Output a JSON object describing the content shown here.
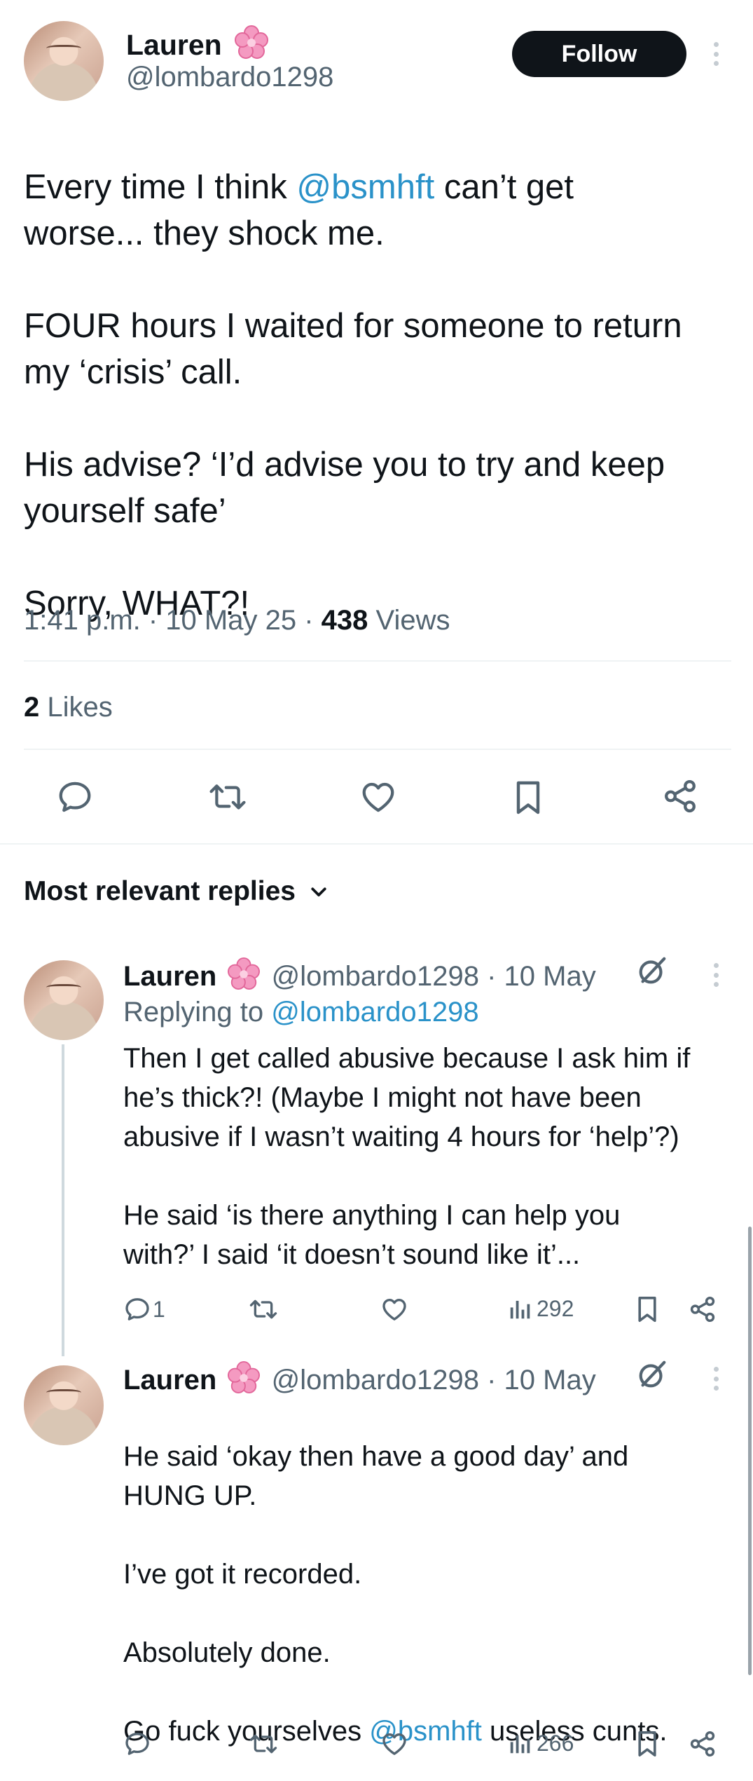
{
  "tweet": {
    "author_name": "Lauren",
    "author_handle": "@lombardo1298",
    "follow_label": "Follow",
    "text_part1": "Every time I think ",
    "mention": "@bsmhft",
    "text_part2": " can’t get\nworse... they shock me.\n\nFOUR hours I waited for someone to return\nmy ‘crisis’ call.\n\nHis advise? ‘I’d advise you to try and keep\nyourself safe’\n\nSorry, WHAT?!",
    "time": "1:41 p.m. · 10 May 25 · ",
    "views_count": "438",
    "views_label": " Views",
    "likes_count": "2",
    "likes_label": " Likes"
  },
  "replies_sort": {
    "label": "Most relevant replies"
  },
  "replies": [
    {
      "author_name": "Lauren",
      "author_handle": "@lombardo1298",
      "date": " · 10 May",
      "replying_prefix": "Replying to ",
      "replying_handle": "@lombardo1298",
      "text": "Then I get called abusive because I ask him if\nhe’s thick?! (Maybe I might not have been\nabusive if I wasn’t waiting 4 hours for ‘help’?)\n\nHe said ‘is there anything I can help you\nwith?’ I said ‘it doesn’t sound like it’...",
      "reply_count": "1",
      "views": "292"
    },
    {
      "author_name": "Lauren",
      "author_handle": "@lombardo1298",
      "date": " · 10 May",
      "text_part1": "He said ‘okay then have a good day’ and\nHUNG UP.\n\nI’ve got it recorded.\n\nAbsolutely done.\n\nGo fuck yourselves ",
      "mention": "@bsmhft",
      "text_part2": " useless cunts.",
      "views": "266"
    }
  ],
  "icons": {
    "emoji": "cherry-blossom-icon",
    "reply": "reply-icon",
    "retweet": "retweet-icon",
    "like": "heart-icon",
    "bookmark": "bookmark-icon",
    "share": "share-icon",
    "analytics": "analytics-icon",
    "grok": "grok-icon",
    "more": "more-icon",
    "chevron": "chevron-down-icon"
  },
  "colors": {
    "text": "#0f1419",
    "secondary": "#536471",
    "link": "#1d9bf0",
    "divider": "#eff3f4"
  }
}
